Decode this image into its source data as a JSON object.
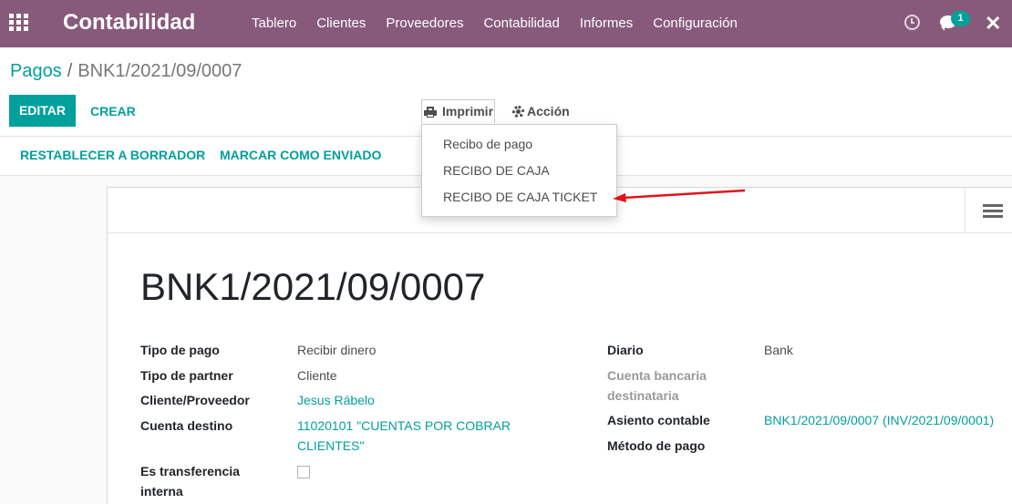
{
  "navbar": {
    "brand": "Contabilidad",
    "menu": [
      "Tablero",
      "Clientes",
      "Proveedores",
      "Contabilidad",
      "Informes",
      "Configuración"
    ],
    "messages_badge": "1"
  },
  "breadcrumb": {
    "parent": "Pagos",
    "separator": "/",
    "current": "BNK1/2021/09/0007"
  },
  "toolbar": {
    "edit_label": "EDITAR",
    "create_label": "CREAR",
    "print_label": "Imprimir",
    "action_label": "Acción"
  },
  "print_menu": {
    "items": [
      "Recibo de pago",
      "RECIBO DE CAJA",
      "RECIBO DE CAJA TICKET"
    ]
  },
  "statusbar": {
    "reset_label": "RESTABLECER A BORRADOR",
    "mark_sent_label": "MARCAR COMO ENVIADO"
  },
  "form": {
    "title": "BNK1/2021/09/0007",
    "left": {
      "payment_type_label": "Tipo de pago",
      "payment_type_value": "Recibir dinero",
      "partner_type_label": "Tipo de partner",
      "partner_type_value": "Cliente",
      "partner_label": "Cliente/Proveedor",
      "partner_value": "Jesus Rábelo",
      "dest_account_label": "Cuenta destino",
      "dest_account_value_line1": "11020101 \"CUENTAS POR COBRAR",
      "dest_account_value_line2": "CLIENTES\"",
      "internal_transfer_label_line1": "Es transferencia",
      "internal_transfer_label_line2": "interna"
    },
    "right": {
      "journal_label": "Diario",
      "journal_value": "Bank",
      "bank_account_label_line1": "Cuenta bancaria",
      "bank_account_label_line2": "destinataria",
      "move_label": "Asiento contable",
      "move_value": "BNK1/2021/09/0007 (INV/2021/09/0001)",
      "method_label": "Método de pago"
    }
  },
  "colors": {
    "navbar": "#875a7b",
    "accent": "#00a09d",
    "annotation_arrow": "#e0151a"
  }
}
